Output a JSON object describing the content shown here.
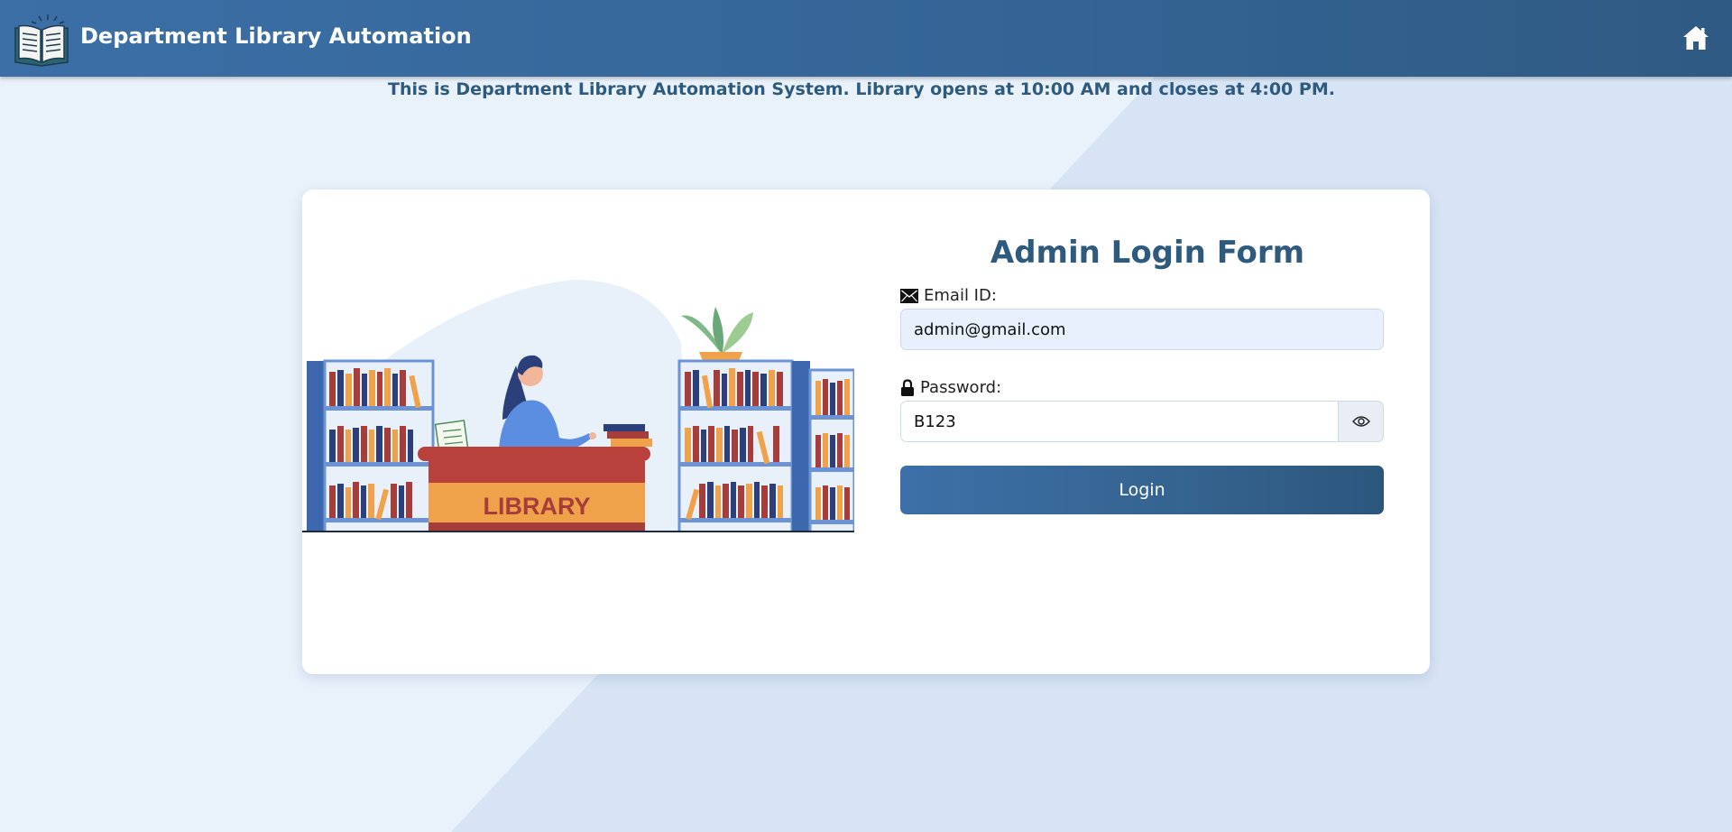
{
  "header": {
    "title": "Department Library Automation",
    "logo_icon": "open-book-icon",
    "home_icon": "home-icon"
  },
  "notice": {
    "text": "This is Department Library Automation System. Library opens at 10:00 AM and closes at 4:00 PM."
  },
  "illustration": {
    "desk_sign": "LIBRARY"
  },
  "login_form": {
    "title": "Admin Login Form",
    "email": {
      "icon": "envelope-icon",
      "label": "Email ID:",
      "value": "admin@gmail.com"
    },
    "password": {
      "icon": "lock-icon",
      "label": "Password:",
      "value": "B123",
      "toggle_icon": "eye-icon"
    },
    "submit_label": "Login"
  },
  "colors": {
    "header_bg": "#356597",
    "accent_text": "#2e5a7e",
    "page_bg": "#e9f1fb",
    "card_bg": "#ffffff"
  }
}
